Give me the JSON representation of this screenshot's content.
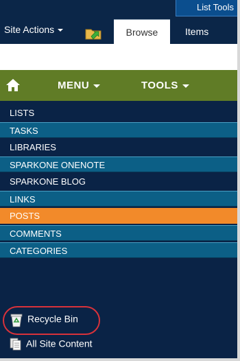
{
  "ribbon": {
    "site_actions": "Site Actions",
    "contextual_group": "List Tools",
    "tabs": [
      {
        "label": "Browse",
        "selected": true
      },
      {
        "label": "Items",
        "selected": false
      }
    ]
  },
  "menubar": {
    "menu_label": "MENU",
    "tools_label": "TOOLS"
  },
  "nav": {
    "items": [
      {
        "label": "LISTS"
      },
      {
        "label": "TASKS"
      },
      {
        "label": "LIBRARIES"
      },
      {
        "label": "SPARKONE ONENOTE"
      },
      {
        "label": "SPARKONE BLOG"
      },
      {
        "label": "LINKS"
      },
      {
        "label": "POSTS",
        "active": true
      },
      {
        "label": "COMMENTS"
      },
      {
        "label": "CATEGORIES"
      }
    ]
  },
  "footer": {
    "recycle_bin": "Recycle Bin",
    "all_site_content": "All Site Content"
  },
  "colors": {
    "background": "#0a2346",
    "menubar": "#607c26",
    "active_item": "#f28a2a",
    "teal_item": "#0c5f86",
    "highlight": "#d9323a"
  }
}
